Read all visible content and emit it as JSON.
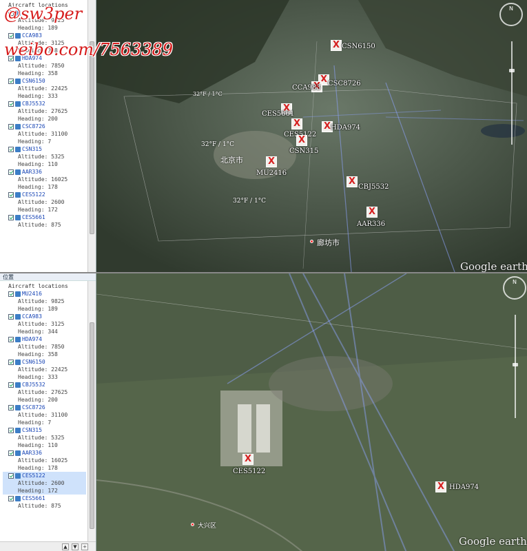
{
  "watermark": {
    "line1": "@sw3per",
    "line2": "weibo.com/7563389"
  },
  "google_earth_logo": "Google earth",
  "colors": {
    "placemark_x": "#d62020",
    "flight_track": "#8ea4ff",
    "selected_row": "#cfe2fb",
    "callsign_text": "#1845b5"
  },
  "sidebar_top": {
    "root_label": "Aircraft locations",
    "aircraft": [
      {
        "callsign": "",
        "altitude": "Altitude: 9825",
        "heading": "Heading: 189"
      },
      {
        "callsign": "CCA983",
        "altitude": "Altitude: 3125",
        "heading": "Heading: 358"
      },
      {
        "callsign": "HDA974",
        "altitude": "Altitude: 7850",
        "heading": "Heading: 358"
      },
      {
        "callsign": "CSN6150",
        "altitude": "Altitude: 22425",
        "heading": "Heading: 333"
      },
      {
        "callsign": "CBJ5532",
        "altitude": "Altitude: 27625",
        "heading": "Heading: 200"
      },
      {
        "callsign": "CSC8726",
        "altitude": "Altitude: 31100",
        "heading": "Heading: 7"
      },
      {
        "callsign": "CSN315",
        "altitude": "Altitude: 5325",
        "heading": "Heading: 110"
      },
      {
        "callsign": "AAR336",
        "altitude": "Altitude: 16025",
        "heading": "Heading: 178"
      },
      {
        "callsign": "CES5122",
        "altitude": "Altitude: 2600",
        "heading": "Heading: 172"
      },
      {
        "callsign": "CES5661",
        "altitude": "Altitude: 875",
        "heading": ""
      }
    ]
  },
  "sidebar_bottom": {
    "header": "位置",
    "root_label": "Aircraft locations",
    "aircraft": [
      {
        "callsign": "MU2416",
        "altitude": "Altitude: 9825",
        "heading": "Heading: 189"
      },
      {
        "callsign": "CCA983",
        "altitude": "Altitude: 3125",
        "heading": "Heading: 344"
      },
      {
        "callsign": "HDA974",
        "altitude": "Altitude: 7850",
        "heading": "Heading: 358"
      },
      {
        "callsign": "CSN6150",
        "altitude": "Altitude: 22425",
        "heading": "Heading: 333"
      },
      {
        "callsign": "CBJ5532",
        "altitude": "Altitude: 27625",
        "heading": "Heading: 200"
      },
      {
        "callsign": "CSC8726",
        "altitude": "Altitude: 31100",
        "heading": "Heading: 7"
      },
      {
        "callsign": "CSN315",
        "altitude": "Altitude: 5325",
        "heading": "Heading: 110"
      },
      {
        "callsign": "AAR336",
        "altitude": "Altitude: 16025",
        "heading": "Heading: 178"
      },
      {
        "callsign": "CES5122",
        "altitude": "Altitude: 2600",
        "heading": "Heading: 172"
      },
      {
        "callsign": "CES5661",
        "altitude": "Altitude: 875",
        "heading": ""
      }
    ],
    "selected_callsign": "CES5122"
  },
  "map_top": {
    "placemarks": [
      {
        "label": "CSN6150"
      },
      {
        "label": "CSC8726"
      },
      {
        "label": "CCA983"
      },
      {
        "label": "CES5661"
      },
      {
        "label": "CES5122"
      },
      {
        "label": "HDA974"
      },
      {
        "label": "CSN315"
      },
      {
        "label": "MU2416"
      },
      {
        "label": "CBJ5532"
      },
      {
        "label": "AAR336"
      }
    ],
    "cities": {
      "beijing": "北京市",
      "langfang": "廊坊市",
      "weather1": "32°F / 1°C",
      "weather2": "32°F / 1°C",
      "weather3": "32°F / 1°C"
    }
  },
  "map_bottom": {
    "placemarks": [
      {
        "label": "CES5122"
      },
      {
        "label": "HDA974"
      }
    ],
    "cities": {
      "daxing": "大兴区"
    }
  }
}
